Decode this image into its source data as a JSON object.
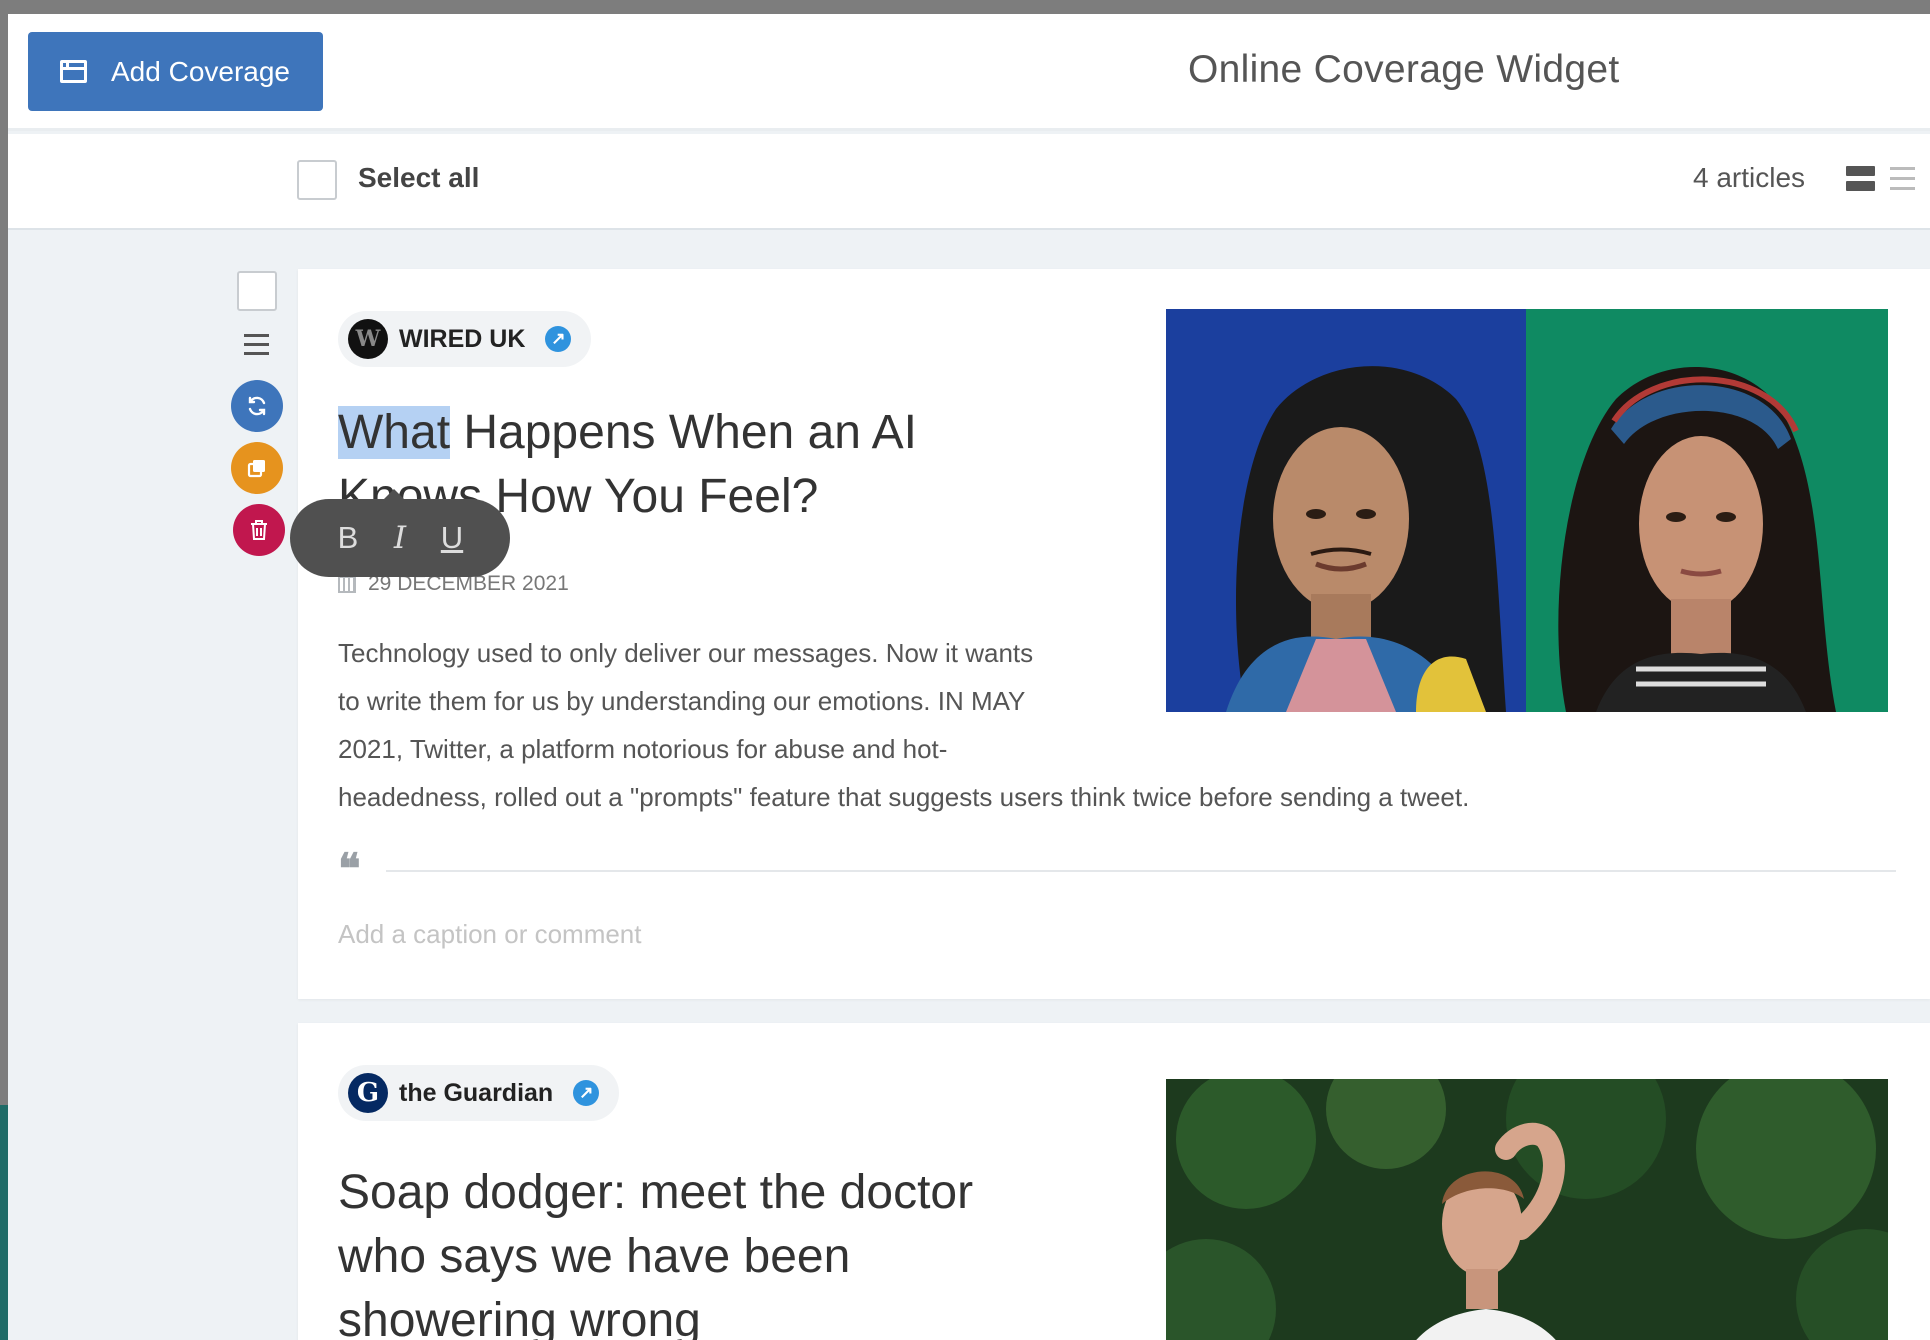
{
  "header": {
    "add_button_label": "Add Coverage",
    "title": "Online Coverage Widget"
  },
  "toolbar": {
    "select_all_label": "Select all",
    "article_count": "4 articles"
  },
  "format_toolbar": {
    "bold": "B",
    "italic": "I",
    "underline": "U"
  },
  "articles": [
    {
      "publication": "WIRED UK",
      "logo_letter": "W",
      "headline_selected": "What",
      "headline_rest": " Happens When an AI Knows How You Feel?",
      "date": "29 DECEMBER 2021",
      "summary": "Technology used to only deliver our messages. Now it wants to write them for us by understanding our emotions. IN MAY 2021, Twitter, a platform notorious for abuse and hot-headedness, rolled out a \"prompts\" feature that suggests users think twice before sending a tweet.",
      "caption_placeholder": "Add a caption or comment"
    },
    {
      "publication": "the Guardian",
      "logo_letter": "G",
      "headline": "Soap dodger: meet the doctor who says we have been showering wrong"
    }
  ],
  "colors": {
    "primary": "#3e75bb",
    "copy": "#e6931e",
    "delete": "#c1174e",
    "link": "#2f93de",
    "selection": "#b5d1f3"
  },
  "icons": {
    "add_button": "calendar-icon",
    "refresh": "refresh-icon",
    "copy": "copy-icon",
    "delete": "trash-icon",
    "external": "external-link-icon",
    "quote": "quote-icon",
    "date": "calendar-icon",
    "view_card": "card-view-icon",
    "view_list": "list-view-icon"
  }
}
